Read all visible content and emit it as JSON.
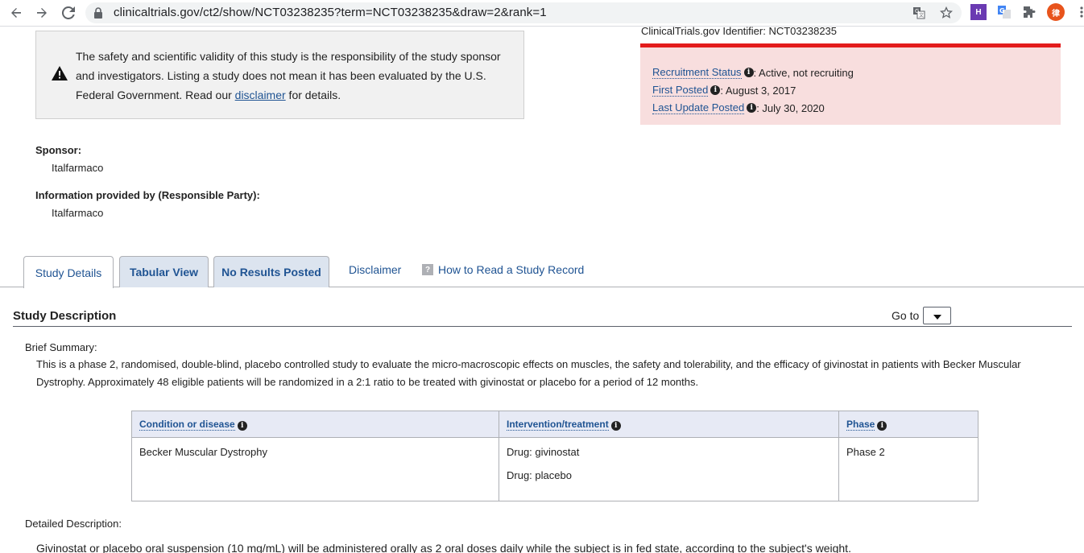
{
  "browser": {
    "url": "clinicaltrials.gov/ct2/show/NCT03238235?term=NCT03238235&draw=2&rank=1",
    "ext_h": "H",
    "profile_initial": "律"
  },
  "identifier": "ClinicalTrials.gov Identifier: NCT03238235",
  "warning": {
    "text_before": "The safety and scientific validity of this study is the responsibility of the study sponsor and investigators. Listing a study does not mean it has been evaluated by the U.S. Federal Government. Read our ",
    "link": "disclaimer",
    "text_after": " for details."
  },
  "status": {
    "recruitment_label": "Recruitment Status",
    "recruitment_value": ": Active, not recruiting",
    "first_posted_label": "First Posted",
    "first_posted_value": ": August 3, 2017",
    "last_update_label": "Last Update Posted",
    "last_update_value": ": July 30, 2020"
  },
  "sponsor": {
    "label": "Sponsor:",
    "value": "Italfarmaco",
    "responsible_label": "Information provided by (Responsible Party):",
    "responsible_value": "Italfarmaco"
  },
  "tabs": {
    "study_details": "Study Details",
    "tabular_view": "Tabular View",
    "no_results": "No Results Posted",
    "disclaimer": "Disclaimer",
    "how_to_read": "How to Read a Study Record"
  },
  "study_description": {
    "title": "Study Description",
    "goto": "Go to",
    "brief_summary_label": "Brief Summary:",
    "brief_summary": "This is a phase 2, randomised, double-blind, placebo controlled study to evaluate the micro-macroscopic effects on muscles, the safety and tolerability, and the efficacy of givinostat in patients with Becker Muscular Dystrophy. Approximately 48 eligible patients will be randomized in a 2:1 ratio to be treated with givinostat or placebo for a period of 12 months.",
    "detailed_label": "Detailed Description:",
    "detailed": "Givinostat or placebo oral suspension (10 mg/mL) will be administered orally as 2 oral doses daily while the subject is in fed state, according to the subject's weight."
  },
  "table": {
    "headers": [
      "Condition or disease",
      "Intervention/treatment",
      "Phase"
    ],
    "condition": "Becker Muscular Dystrophy",
    "interventions": [
      "Drug: givinostat",
      "Drug: placebo"
    ],
    "phase": "Phase 2"
  },
  "colors": {
    "link": "#205493",
    "status_bg": "#f8dede",
    "status_bar": "#e31c1c"
  }
}
